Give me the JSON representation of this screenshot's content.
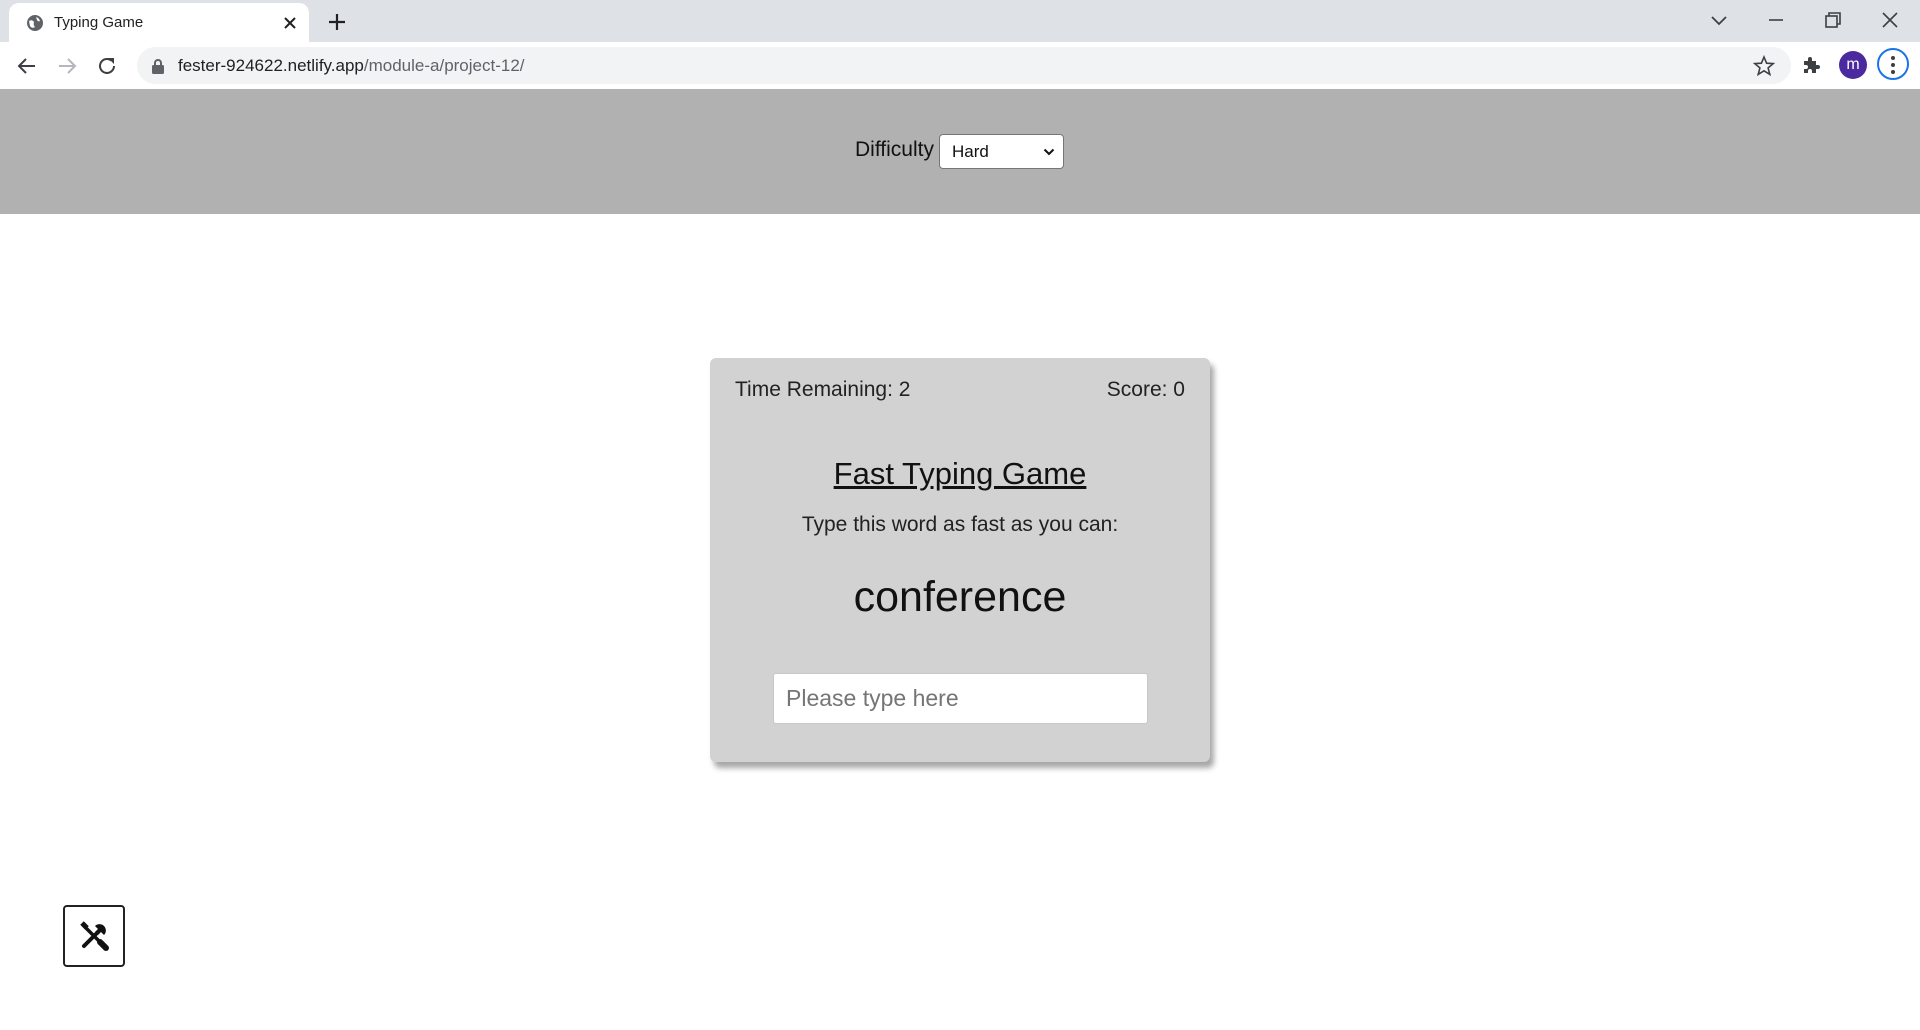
{
  "browser": {
    "tab_title": "Typing Game",
    "url_host": "fester-924622.netlify.app",
    "url_path": "/module-a/project-12/",
    "profile_initial": "m",
    "accent_color": "#1a73e8",
    "profile_color": "#4a2a9e",
    "icons": [
      "globe-icon",
      "close-icon",
      "plus-icon",
      "chevron-down-icon",
      "minimize-icon",
      "restore-icon",
      "back-icon",
      "forward-icon",
      "reload-icon",
      "lock-icon",
      "star-icon",
      "puzzle-icon",
      "kebab-menu-icon"
    ]
  },
  "header": {
    "difficulty_label": "Difficulty",
    "difficulty_value": "Hard",
    "background_color": "#b1b1b1"
  },
  "game": {
    "time_remaining": "Time Remaining: 2",
    "score": "Score: 0",
    "title": "Fast Typing Game",
    "instruction": "Type this word as fast as you can:",
    "word": "conference",
    "input_placeholder": "Please type here",
    "input_value": "",
    "card_color": "#d2d2d2"
  },
  "settings": {
    "icon": "tools-icon"
  }
}
